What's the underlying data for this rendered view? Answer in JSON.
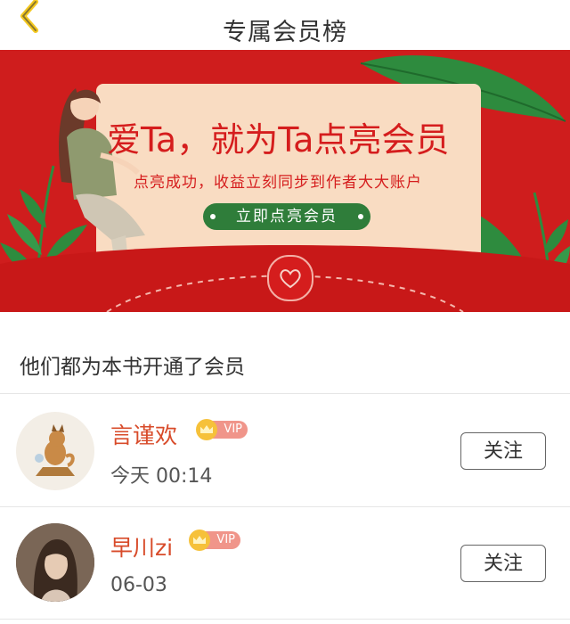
{
  "header": {
    "title": "专属会员榜",
    "back_icon": "chevron-left-icon"
  },
  "banner": {
    "headline": "爱Ta，就为Ta点亮会员",
    "subtitle": "点亮成功，收益立刻同步到作者大大账户",
    "button_label": "立即点亮会员",
    "colors": {
      "background": "#cf1d1d",
      "card": "#f9dcc2",
      "button": "#2f7d3a",
      "leaf": "#2e8b3e"
    }
  },
  "section": {
    "title": "他们都为本书开通了会员"
  },
  "members": [
    {
      "name": "言谨欢",
      "badge": "VIP",
      "time": "今天 00:14",
      "follow_label": "关注",
      "avatar_icon": "fox-avatar"
    },
    {
      "name": "早川zi",
      "badge": "VIP",
      "time": "06-03",
      "follow_label": "关注",
      "avatar_icon": "girl-photo-avatar"
    }
  ]
}
